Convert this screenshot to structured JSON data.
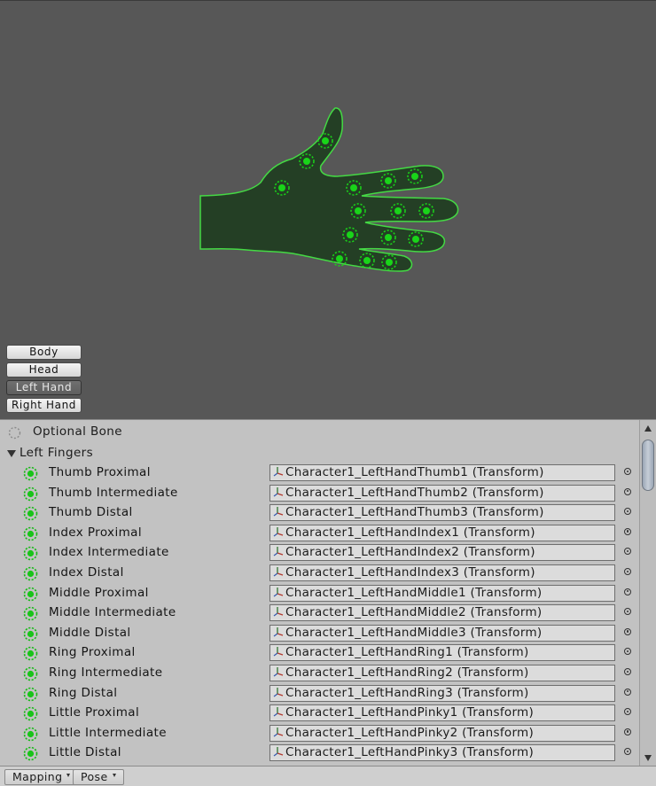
{
  "body_parts": [
    "Body",
    "Head",
    "Left Hand",
    "Right Hand"
  ],
  "active_part": "Left Hand",
  "colors": {
    "viewport_bg": "#575757",
    "hand_fill": "#243f25",
    "hand_outline": "#44d944",
    "bone_dot": "#19d419"
  },
  "optional_bone_label": "Optional Bone",
  "section": {
    "title": "Left Fingers",
    "expanded": true
  },
  "bones": [
    {
      "label": "Thumb Proximal",
      "value": "Character1_LeftHandThumb1 (Transform)"
    },
    {
      "label": "Thumb Intermediate",
      "value": "Character1_LeftHandThumb2 (Transform)"
    },
    {
      "label": "Thumb Distal",
      "value": "Character1_LeftHandThumb3 (Transform)"
    },
    {
      "label": "Index Proximal",
      "value": "Character1_LeftHandIndex1 (Transform)"
    },
    {
      "label": "Index Intermediate",
      "value": "Character1_LeftHandIndex2 (Transform)"
    },
    {
      "label": "Index Distal",
      "value": "Character1_LeftHandIndex3 (Transform)"
    },
    {
      "label": "Middle Proximal",
      "value": "Character1_LeftHandMiddle1 (Transform)"
    },
    {
      "label": "Middle Intermediate",
      "value": "Character1_LeftHandMiddle2 (Transform)"
    },
    {
      "label": "Middle Distal",
      "value": "Character1_LeftHandMiddle3 (Transform)"
    },
    {
      "label": "Ring Proximal",
      "value": "Character1_LeftHandRing1 (Transform)"
    },
    {
      "label": "Ring Intermediate",
      "value": "Character1_LeftHandRing2 (Transform)"
    },
    {
      "label": "Ring Distal",
      "value": "Character1_LeftHandRing3 (Transform)"
    },
    {
      "label": "Little Proximal",
      "value": "Character1_LeftHandPinky1 (Transform)"
    },
    {
      "label": "Little Intermediate",
      "value": "Character1_LeftHandPinky2 (Transform)"
    },
    {
      "label": "Little Distal",
      "value": "Character1_LeftHandPinky3 (Transform)"
    }
  ],
  "bottom_bar": {
    "mapping_label": "Mapping",
    "pose_label": "Pose"
  }
}
